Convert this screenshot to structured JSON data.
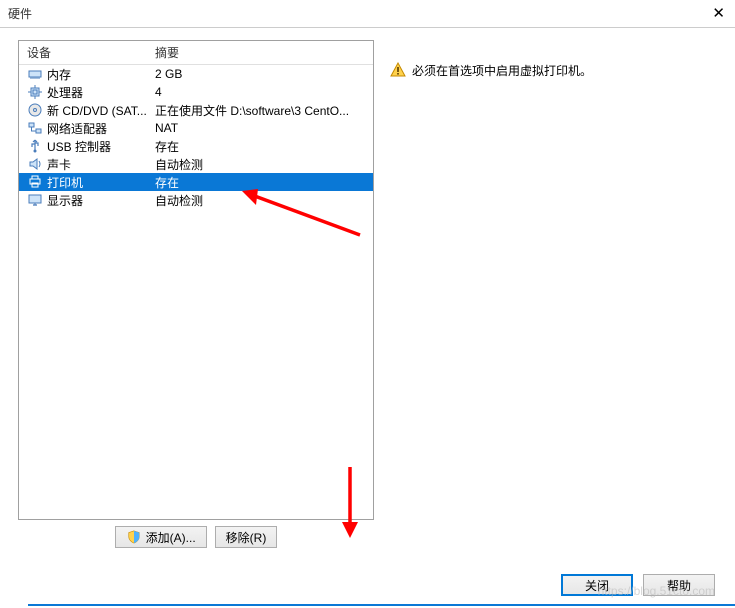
{
  "title": "硬件",
  "headers": {
    "device": "设备",
    "summary": "摘要"
  },
  "rows": [
    {
      "name": "内存",
      "summary": "2 GB",
      "icon": "memory"
    },
    {
      "name": "处理器",
      "summary": "4",
      "icon": "cpu"
    },
    {
      "name": "新 CD/DVD (SAT...",
      "summary": "正在使用文件 D:\\software\\3 CentO...",
      "icon": "cd"
    },
    {
      "name": "网络适配器",
      "summary": "NAT",
      "icon": "network"
    },
    {
      "name": "USB 控制器",
      "summary": "存在",
      "icon": "usb"
    },
    {
      "name": "声卡",
      "summary": "自动检测",
      "icon": "sound"
    },
    {
      "name": "打印机",
      "summary": "存在",
      "icon": "printer",
      "selected": true
    },
    {
      "name": "显示器",
      "summary": "自动检测",
      "icon": "display"
    }
  ],
  "buttons": {
    "add": "添加(A)...",
    "remove": "移除(R)"
  },
  "warning_text": "必须在首选项中启用虚拟打印机。",
  "footer": {
    "close": "关闭",
    "help": "帮助"
  }
}
